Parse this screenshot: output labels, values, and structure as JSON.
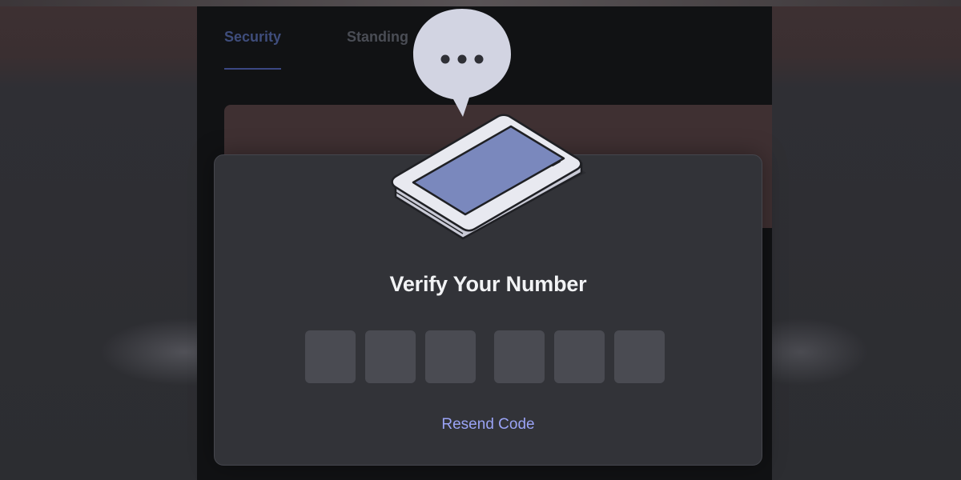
{
  "tabs": [
    {
      "label": "Security",
      "active": true
    },
    {
      "label": "Standing",
      "active": false
    }
  ],
  "modal": {
    "title": "Verify Your Number",
    "code_length": 6,
    "code_digits": [
      "",
      "",
      "",
      "",
      "",
      ""
    ],
    "resend_label": "Resend Code"
  },
  "icons": {
    "speech_bubble": "speech-bubble-ellipsis-icon",
    "phone": "smartphone-icon"
  },
  "colors": {
    "modal_bg": "#323338",
    "window_bg": "#111214",
    "banner_bg": "#3f3032",
    "code_box_bg": "#4a4b52",
    "link": "#9aa3f5",
    "title_text": "#f2f3f5",
    "phone_screen": "#7a88bd",
    "bubble": "#d2d4e2"
  }
}
